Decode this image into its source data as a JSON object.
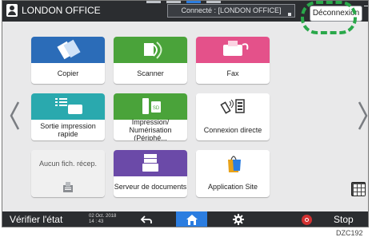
{
  "header": {
    "office_name": "LONDON OFFICE",
    "connection_status": "Connecté : [LONDON OFFICE]",
    "logout_label": "Déconnexion"
  },
  "tiles": [
    {
      "label": "Copier",
      "color": "#2b6cb8"
    },
    {
      "label": "Scanner",
      "color": "#4aa33a"
    },
    {
      "label": "Fax",
      "color": "#e4518a"
    },
    {
      "label": "Sortie impression rapide",
      "color": "#2aa9ae"
    },
    {
      "label_line1": "Impression/",
      "label_line2": "Numérisation (Périphé...",
      "color": "#4aa33a"
    },
    {
      "label": "Connexion directe",
      "color": "#ffffff"
    },
    {
      "label": "Aucun fich. récep.",
      "color": "#f0f0f0"
    },
    {
      "label": "Serveur de documents",
      "color": "#6b4aa8"
    },
    {
      "label": "Application Site",
      "color": "#ffffff"
    }
  ],
  "page_indicator": {
    "pages": 4,
    "active": 2
  },
  "footer": {
    "status_label": "Vérifier l'état",
    "date": "02 Oct. 2018",
    "time": "14 : 43",
    "stop_label": "Stop"
  },
  "figure_code": "DZC192",
  "icons": [
    "user-icon",
    "back-icon",
    "home-icon",
    "gear-icon",
    "stop-icon",
    "app-grid-icon",
    "left-arrow-icon",
    "right-arrow-icon"
  ],
  "colors": {
    "accent": "#2b7de0",
    "highlight_ring": "#2aa84a"
  }
}
